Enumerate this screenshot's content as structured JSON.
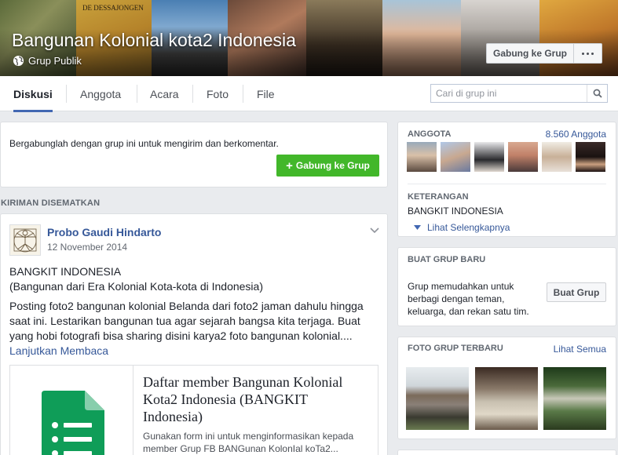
{
  "header": {
    "group_name": "Bangunan Kolonial kota2 Indonesia",
    "privacy_label": "Grup Publik",
    "cover_sign_text": "DE DESSAJONGEN",
    "join_button": "Gabung ke Grup",
    "more_icon": "ellipsis-icon"
  },
  "tabs": [
    {
      "label": "Diskusi",
      "active": true
    },
    {
      "label": "Anggota",
      "active": false
    },
    {
      "label": "Acara",
      "active": false
    },
    {
      "label": "Foto",
      "active": false
    },
    {
      "label": "File",
      "active": false
    }
  ],
  "search": {
    "placeholder": "Cari di grup ini",
    "icon": "search-icon"
  },
  "join_prompt": {
    "text": "Bergabunglah dengan grup ini untuk mengirim dan berkomentar.",
    "button": "Gabung ke Grup"
  },
  "pinned": {
    "heading": "KIRIMAN DISEMATKAN",
    "author": "Probo Gaudi Hindarto",
    "date": "12 November 2014",
    "line1": "BANGKIT INDONESIA",
    "line2": "(Bangunan dari Era Kolonial Kota-kota di Indonesia)",
    "paragraph": "Posting foto2 bangunan kolonial Belanda dari foto2 jaman dahulu hingga saat ini. Lestarikan bangunan tua agar sejarah bangsa kita terjaga. Buat yang hobi fotografi bisa sharing disini karya2 foto bangunan kolonial....",
    "read_more": "Lanjutkan Membaca",
    "link_title": "Daftar member Bangunan Kolonial Kota2 Indonesia (BANGKIT Indonesia)",
    "link_desc": "Gunakan form ini untuk menginformasikan kepada member Grup FB BANGunan KolonIal koTa2..."
  },
  "members": {
    "heading": "ANGGOTA",
    "count": "8.560 Anggota"
  },
  "about": {
    "heading": "KETERANGAN",
    "text": "BANGKIT INDONESIA",
    "see_more": "Lihat Selengkapnya"
  },
  "create_group": {
    "heading": "BUAT GRUP BARU",
    "text": "Grup memudahkan untuk berbagi dengan teman, keluarga, dan rekan satu tim.",
    "button": "Buat Grup"
  },
  "recent_photos": {
    "heading": "FOTO GRUP TERBARU",
    "see_all": "Lihat Semua"
  },
  "colors": {
    "brand_blue": "#4267b2",
    "link_blue": "#365899",
    "join_green": "#42b72a",
    "page_bg": "#e9ebee"
  }
}
